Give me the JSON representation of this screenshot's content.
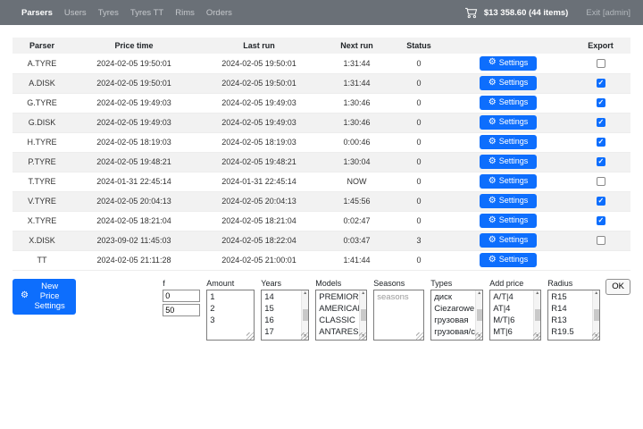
{
  "nav": {
    "items": [
      {
        "label": "Parsers",
        "active": true
      },
      {
        "label": "Users",
        "active": false
      },
      {
        "label": "Tyres",
        "active": false
      },
      {
        "label": "Tyres TT",
        "active": false
      },
      {
        "label": "Rims",
        "active": false
      },
      {
        "label": "Orders",
        "active": false
      }
    ],
    "cart_total": "$13 358.60 (44 items)",
    "exit_label": "Exit [admin]"
  },
  "table": {
    "headers": [
      "Parser",
      "Price time",
      "Last run",
      "Next run",
      "Status",
      "",
      "Export"
    ],
    "settings_label": "Settings",
    "rows": [
      {
        "parser": "A.TYRE",
        "price_time": "2024-02-05 19:50:01",
        "last_run": "2024-02-05 19:50:01",
        "next_run": "1:31:44",
        "status": "0",
        "export": "unchecked"
      },
      {
        "parser": "A.DISK",
        "price_time": "2024-02-05 19:50:01",
        "last_run": "2024-02-05 19:50:01",
        "next_run": "1:31:44",
        "status": "0",
        "export": "checked"
      },
      {
        "parser": "G.TYRE",
        "price_time": "2024-02-05 19:49:03",
        "last_run": "2024-02-05 19:49:03",
        "next_run": "1:30:46",
        "status": "0",
        "export": "checked"
      },
      {
        "parser": "G.DISK",
        "price_time": "2024-02-05 19:49:03",
        "last_run": "2024-02-05 19:49:03",
        "next_run": "1:30:46",
        "status": "0",
        "export": "checked"
      },
      {
        "parser": "H.TYRE",
        "price_time": "2024-02-05 18:19:03",
        "last_run": "2024-02-05 18:19:03",
        "next_run": "0:00:46",
        "status": "0",
        "export": "checked"
      },
      {
        "parser": "P.TYRE",
        "price_time": "2024-02-05 19:48:21",
        "last_run": "2024-02-05 19:48:21",
        "next_run": "1:30:04",
        "status": "0",
        "export": "checked"
      },
      {
        "parser": "T.TYRE",
        "price_time": "2024-01-31 22:45:14",
        "last_run": "2024-01-31 22:45:14",
        "next_run": "NOW",
        "status": "0",
        "export": "unchecked"
      },
      {
        "parser": "V.TYRE",
        "price_time": "2024-02-05 20:04:13",
        "last_run": "2024-02-05 20:04:13",
        "next_run": "1:45:56",
        "status": "0",
        "export": "checked"
      },
      {
        "parser": "X.TYRE",
        "price_time": "2024-02-05 18:21:04",
        "last_run": "2024-02-05 18:21:04",
        "next_run": "0:02:47",
        "status": "0",
        "export": "checked"
      },
      {
        "parser": "X.DISK",
        "price_time": "2023-09-02 11:45:03",
        "last_run": "2024-02-05 18:22:04",
        "next_run": "0:03:47",
        "status": "3",
        "export": "unchecked"
      },
      {
        "parser": "TT",
        "price_time": "2024-02-05 21:11:28",
        "last_run": "2024-02-05 21:00:01",
        "next_run": "1:41:44",
        "status": "0",
        "export": "none"
      }
    ]
  },
  "footer": {
    "new_price_settings_label": "New Price Settings",
    "ok_label": "OK",
    "fields": {
      "f": {
        "label": "f",
        "values": [
          "0",
          "50"
        ]
      },
      "amount": {
        "label": "Amount",
        "options": [
          "1",
          "2",
          "3"
        ]
      },
      "years": {
        "label": "Years",
        "options": [
          "14",
          "15",
          "16",
          "17"
        ]
      },
      "models": {
        "label": "Models",
        "options": [
          "PREMIORRI",
          "AMERICAN",
          "CLASSIC",
          "ANTARES"
        ]
      },
      "seasons": {
        "label": "Seasons",
        "placeholder": "seasons"
      },
      "types": {
        "label": "Types",
        "options": [
          "диск",
          "Ciezarowe",
          "грузовая",
          "грузовая/с/"
        ]
      },
      "add_price": {
        "label": "Add price",
        "options": [
          "A/T|4",
          "AT|4",
          "M/T|6",
          "MT|6"
        ]
      },
      "radius": {
        "label": "Radius",
        "options": [
          "R15",
          "R14",
          "R13",
          "R19.5"
        ]
      }
    }
  },
  "colors": {
    "accent_blue": "#0d6efd",
    "navbar_bg": "#6a7077",
    "row_stripe": "#f2f2f2"
  }
}
